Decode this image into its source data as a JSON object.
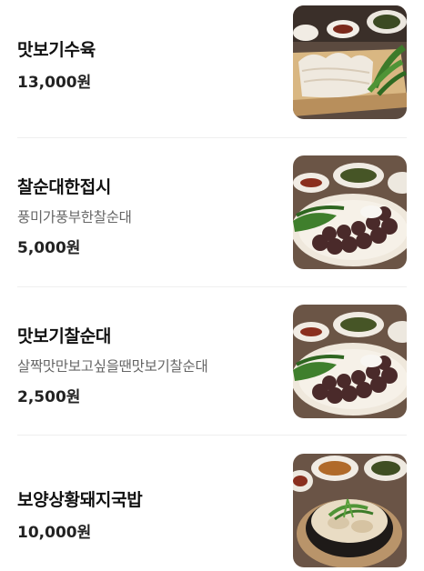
{
  "menu": {
    "items": [
      {
        "name": "맛보기수육",
        "desc": "",
        "price": "13,000원",
        "image": "boiled-pork-photo"
      },
      {
        "name": "찰순대한접시",
        "desc": "풍미가풍부한찰순대",
        "price": "5,000원",
        "image": "sundae-plate-photo"
      },
      {
        "name": "맛보기찰순대",
        "desc": "살짝맛만보고싶을땐맛보기찰순대",
        "price": "2,500원",
        "image": "sundae-sample-photo"
      },
      {
        "name": "보양상황돼지국밥",
        "desc": "",
        "price": "10,000원",
        "image": "pork-soup-photo"
      }
    ]
  }
}
